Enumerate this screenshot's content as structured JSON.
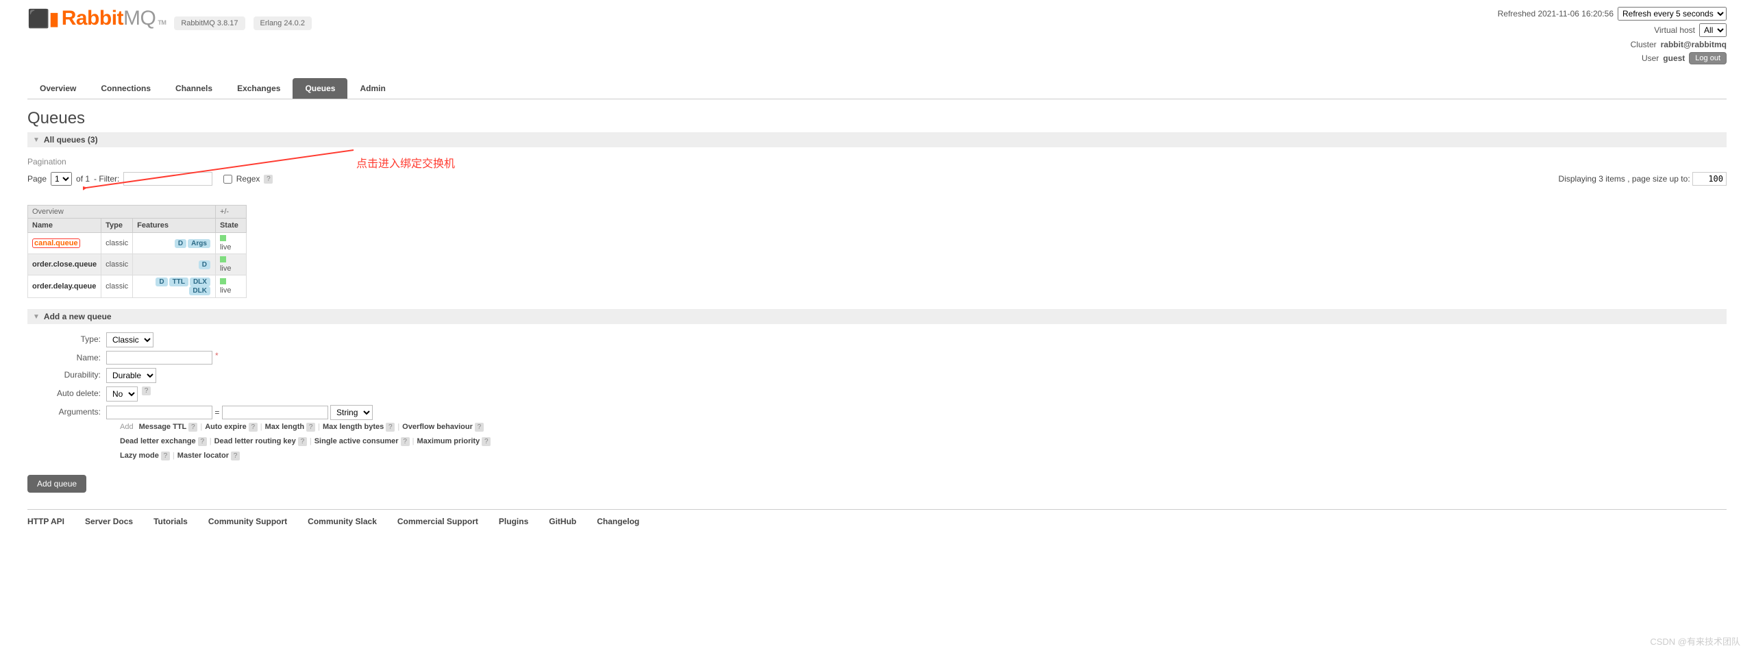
{
  "status": {
    "refreshed": "Refreshed 2021-11-06 16:20:56",
    "refresh_options": [
      "Refresh every 5 seconds"
    ],
    "vhost_label": "Virtual host",
    "vhost_options": [
      "All"
    ],
    "cluster_label": "Cluster",
    "cluster_value": "rabbit@rabbitmq",
    "user_label": "User",
    "user_value": "guest",
    "logout": "Log out"
  },
  "logo": {
    "brand1": "Rabbit",
    "brand2": "MQ",
    "tm": "TM",
    "v1": "RabbitMQ 3.8.17",
    "v2": "Erlang 24.0.2"
  },
  "tabs": [
    "Overview",
    "Connections",
    "Channels",
    "Exchanges",
    "Queues",
    "Admin"
  ],
  "tabs_active": 4,
  "page_title": "Queues",
  "all_queues": {
    "label": "All queues (3)"
  },
  "pagination": {
    "label": "Pagination",
    "page_lbl": "Page",
    "page_sel": "1",
    "of": "of 1",
    "filter_lbl": "- Filter:",
    "filter_val": "",
    "regex_lbl": "Regex",
    "display": "Displaying 3 items , page size up to:",
    "page_size": "100"
  },
  "table": {
    "groups": {
      "overview": "Overview",
      "pm": "+/-"
    },
    "cols": {
      "name": "Name",
      "type": "Type",
      "features": "Features",
      "state": "State"
    },
    "rows": [
      {
        "name": "canal.queue",
        "type": "classic",
        "features": [
          "D",
          "Args"
        ],
        "state": "live",
        "highlight": true
      },
      {
        "name": "order.close.queue",
        "type": "classic",
        "features": [
          "D"
        ],
        "state": "live"
      },
      {
        "name": "order.delay.queue",
        "type": "classic",
        "features": [
          "D",
          "TTL",
          "DLX",
          "DLK"
        ],
        "state": "live"
      }
    ]
  },
  "add_queue": {
    "header": "Add a new queue",
    "type_lbl": "Type:",
    "type_sel": "Classic",
    "name_lbl": "Name:",
    "name_val": "",
    "dur_lbl": "Durability:",
    "dur_sel": "Durable",
    "ad_lbl": "Auto delete:",
    "ad_sel": "No",
    "args_lbl": "Arguments:",
    "arg_k": "",
    "arg_v": "",
    "arg_t": "String",
    "add_hint_lbl": "Add",
    "hints_l1": [
      "Message TTL",
      "Auto expire",
      "Max length",
      "Max length bytes",
      "Overflow behaviour"
    ],
    "hints_l2": [
      "Dead letter exchange",
      "Dead letter routing key",
      "Single active consumer",
      "Maximum priority"
    ],
    "hints_l3": [
      "Lazy mode",
      "Master locator"
    ],
    "submit": "Add queue"
  },
  "footer": [
    "HTTP API",
    "Server Docs",
    "Tutorials",
    "Community Support",
    "Community Slack",
    "Commercial Support",
    "Plugins",
    "GitHub",
    "Changelog"
  ],
  "annotation": "点击进入绑定交换机",
  "watermark": "CSDN @有来技术团队"
}
